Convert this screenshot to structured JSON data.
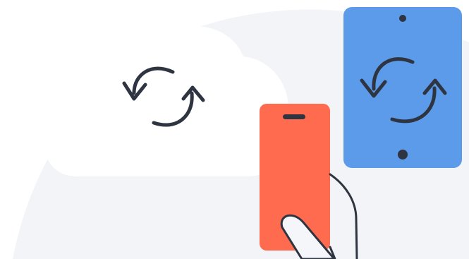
{
  "illustration": {
    "icons": {
      "cloud": "cloud-icon",
      "sync": "sync-icon",
      "phone": "phone-icon",
      "tablet": "tablet-icon",
      "hand": "hand-icon"
    },
    "colors": {
      "background_blob": "#F3F4F8",
      "cloud": "#FFFFFF",
      "phone": "#FF6B4F",
      "tablet": "#5B9BEA",
      "stroke": "#2E3440",
      "hand_fill": "#F5F6FA"
    }
  }
}
